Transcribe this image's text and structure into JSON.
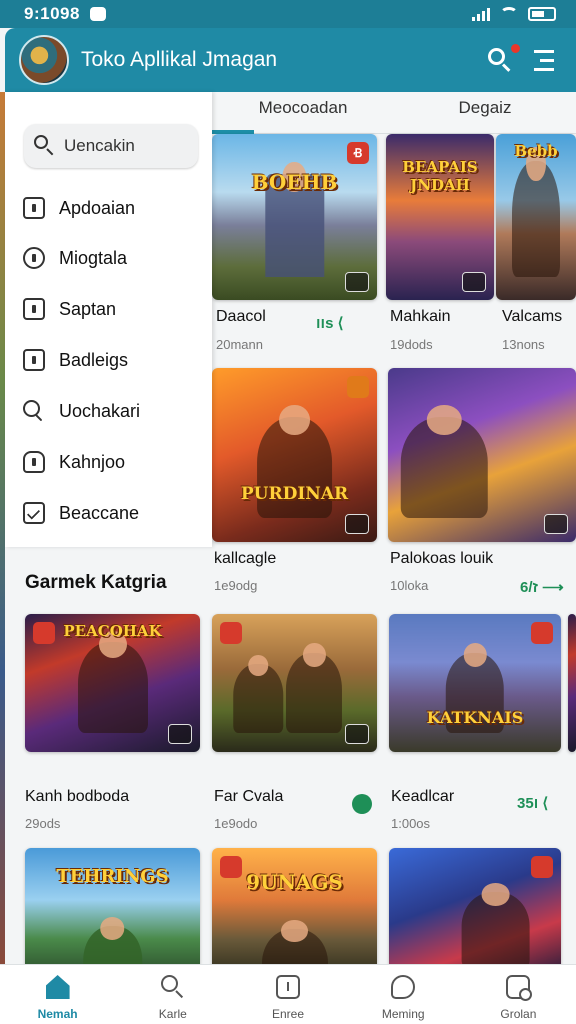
{
  "status_bar": {
    "time": "9:1098"
  },
  "header": {
    "title": "Toko Apllikal Jmagan"
  },
  "tabs": [
    {
      "label": "Meocoadan"
    },
    {
      "label": "Degaiz"
    }
  ],
  "drawer": {
    "search_placeholder": "Uencakin",
    "items": [
      {
        "label": "Apdoaian",
        "icon": "app-box-icon"
      },
      {
        "label": "Miogtala",
        "icon": "badge-icon"
      },
      {
        "label": "Saptan",
        "icon": "square-dot-icon"
      },
      {
        "label": "Badleigs",
        "icon": "box-icon"
      },
      {
        "label": "Uochakari",
        "icon": "search-icon"
      },
      {
        "label": "Kahnjoo",
        "icon": "cloud-icon"
      },
      {
        "label": "Beaccane",
        "icon": "checkbox-icon"
      }
    ]
  },
  "section": {
    "title": "Garmek Katgria"
  },
  "top_games": [
    {
      "title": "Daacol",
      "sub": "20mann",
      "meta": "ווs ⟨",
      "badge": "Ꞗ",
      "logo": "BOEHB"
    },
    {
      "title": "Mahkain",
      "sub": "19dods",
      "meta": "",
      "badge": "",
      "logo": "BEAPAIS JNDAH"
    },
    {
      "title": "Valcams",
      "sub": "13nons",
      "meta": "",
      "badge": "",
      "logo": "Bebb"
    }
  ],
  "mid_games": [
    {
      "title": "kallcagle",
      "sub": "1e9odg",
      "meta": "",
      "logo": "PURDINAR"
    },
    {
      "title": "Palokoas louik",
      "sub": "10loka",
      "meta": "ז/6 ⟶",
      "logo": ""
    }
  ],
  "category_games": [
    {
      "title": "Kanh bodboda",
      "sub": "29ods",
      "meta": "",
      "logo": "PEACOHAK"
    },
    {
      "title": "Far Cvala",
      "sub": "1e9odo",
      "meta": "",
      "logo": ""
    },
    {
      "title": "Keadlcar",
      "sub": "1:00os",
      "meta": "ו35 ⟨",
      "logo": "KATKNAIS"
    }
  ],
  "bottom_row_logos": [
    "TEHRINGS",
    "9UNAGS",
    ""
  ],
  "bottom_nav": [
    {
      "label": "Nemah",
      "active": true
    },
    {
      "label": "Karle",
      "active": false
    },
    {
      "label": "Enree",
      "active": false
    },
    {
      "label": "Meming",
      "active": false
    },
    {
      "label": "Grolan",
      "active": false
    }
  ],
  "colors": {
    "accent": "#1f8aa5",
    "header": "#1f8aa5",
    "status_bar": "#1d7e96",
    "meta_green": "#1e8f57",
    "badge_red": "#d63a2c"
  }
}
